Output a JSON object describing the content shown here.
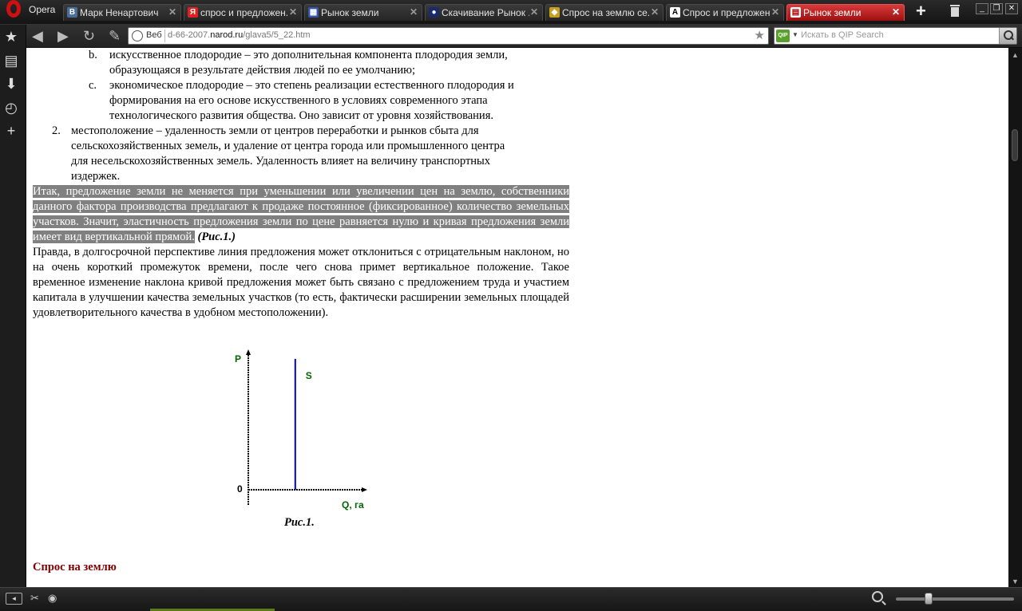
{
  "browser": {
    "name": "Opera",
    "tabs": [
      {
        "label": "Марк Ненартович",
        "favicon": "vk-icon",
        "active": false
      },
      {
        "label": "спрос и предложен...",
        "favicon": "yandex-icon",
        "active": false
      },
      {
        "label": "Рынок земли",
        "favicon": "page-icon",
        "active": false
      },
      {
        "label": "Скачивание Рынок ...",
        "favicon": "download-icon",
        "active": false
      },
      {
        "label": "Спрос на землю се...",
        "favicon": "tag-icon",
        "active": false
      },
      {
        "label": "Спрос и предложен...",
        "favicon": "a-icon",
        "active": false
      },
      {
        "label": "Рынок земли",
        "favicon": "document-icon",
        "active": true
      }
    ],
    "address": {
      "prefix": "Веб",
      "url_pre": "d-66-2007.",
      "url_host": "narod.ru",
      "url_post": "/glava5/5_22.htm"
    },
    "search": {
      "placeholder": "Искать в QIP Search",
      "engine": "QIP"
    }
  },
  "content": {
    "list_b": {
      "marker": "b.",
      "lines": [
        "искусственное плодородие – это дополнительная компонента плодородия земли,",
        "образующаяся в результате действия людей по ее умолчанию;"
      ]
    },
    "list_c": {
      "marker": "c.",
      "lines": [
        "экономическое плодородие – это степень реализации естественного плодородия и",
        "формирования на его основе искусственного в условиях современного этапа",
        "технологического развития общества. Оно зависит от уровня хозяйствования."
      ]
    },
    "list_2": {
      "marker": "2.",
      "lines": [
        "местоположение – удаленность земли от центров переработки и рынков сбыта для",
        "сельскохозяйственных земель, и удаление от центра города или промышленного центра",
        "для несельскохозяйственных земель. Удаленность влияет на величину транспортных",
        "издержек."
      ]
    },
    "highlighted_para": "Итак, предложение земли не меняется при уменьшении или увеличении цен на землю, собственники данного фактора производства предлагают к продаже постоянное (фиксированное) количество земельных участков. Значит, эластичность предложения земли по цене равняется нулю и кривая предложения земли имеет вид вертикальной прямой.",
    "figure_ref": "(Рис.1.)",
    "para2": "Правда, в долгосрочной перспективе линия предложения может отклониться с отрицательным наклоном, но на очень короткий промежуток времени, после чего снова примет вертикальное положение. Такое временное изменение наклона кривой предложения может быть связано с предложением труда и участием капитала в улучшении качества земельных участков (то есть, фактически расширении земельных площадей удовлетворительного качества в удобном местоположении).",
    "caption": "Рис.1.",
    "section_heading": "Спрос на землю"
  },
  "chart_data": {
    "type": "line",
    "title": "",
    "xlabel": "Q, га",
    "ylabel": "P",
    "origin_label": "0",
    "series": [
      {
        "name": "S",
        "x": [
          0.4,
          0.4
        ],
        "y": [
          0,
          1
        ],
        "color": "#0000cc"
      }
    ],
    "xlim": [
      0,
      1
    ],
    "ylim": [
      0,
      1.06
    ],
    "grid": false,
    "label_color": "#006600"
  },
  "statusbar": {
    "zoom_level": 0.28
  }
}
